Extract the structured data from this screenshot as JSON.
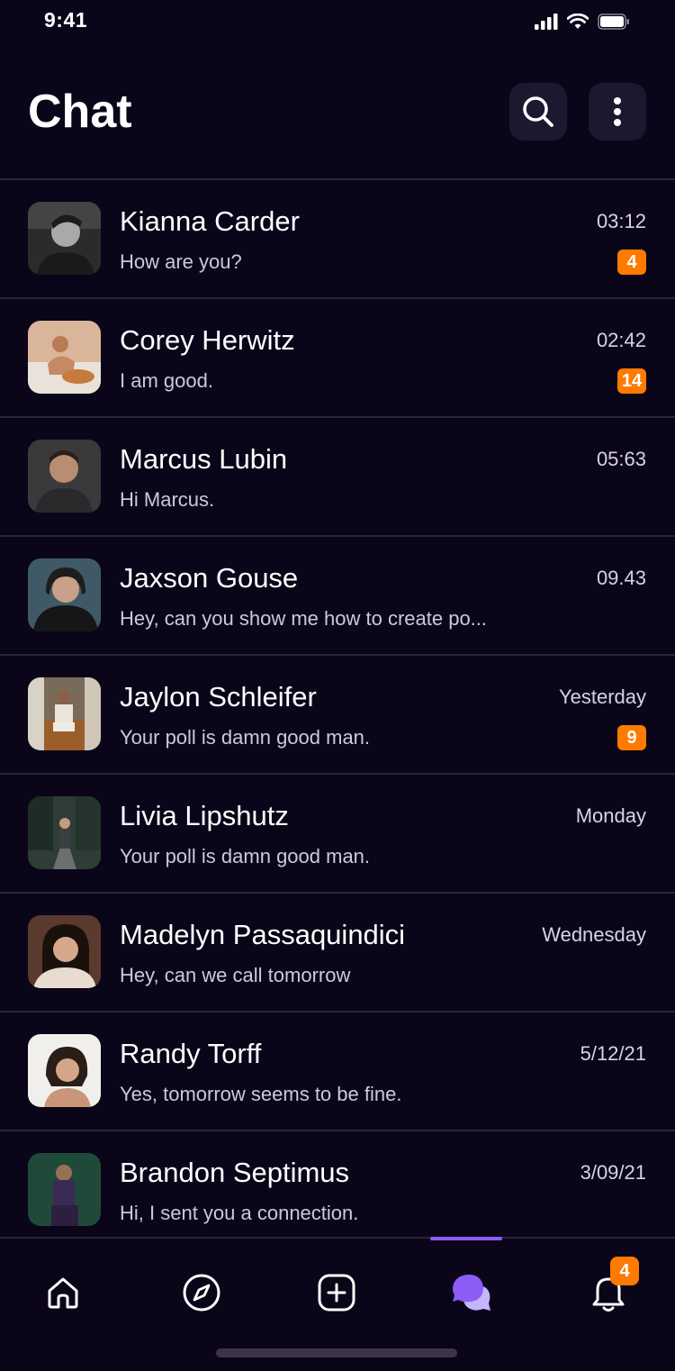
{
  "status_bar": {
    "time": "9:41"
  },
  "header": {
    "title": "Chat"
  },
  "chats": [
    {
      "name": "Kianna Carder",
      "preview": "How are you?",
      "time": "03:12",
      "unread": "4"
    },
    {
      "name": "Corey Herwitz",
      "preview": "I am good.",
      "time": "02:42",
      "unread": "14"
    },
    {
      "name": "Marcus Lubin",
      "preview": "Hi Marcus.",
      "time": "05:63",
      "unread": ""
    },
    {
      "name": "Jaxson Gouse",
      "preview": "Hey, can you show me how to create po...",
      "time": "09.43",
      "unread": ""
    },
    {
      "name": "Jaylon Schleifer",
      "preview": "Your poll is damn good man.",
      "time": "Yesterday",
      "unread": "9"
    },
    {
      "name": "Livia Lipshutz",
      "preview": "Your poll is damn good man.",
      "time": "Monday",
      "unread": ""
    },
    {
      "name": "Madelyn Passaquindici",
      "preview": "Hey, can we call tomorrow",
      "time": "Wednesday",
      "unread": ""
    },
    {
      "name": "Randy Torff",
      "preview": "Yes, tomorrow seems to be fine.",
      "time": "5/12/21",
      "unread": ""
    },
    {
      "name": "Brandon Septimus",
      "preview": "Hi, I sent you a connection.",
      "time": "3/09/21",
      "unread": ""
    }
  ],
  "tabbar": {
    "items": [
      "home-icon",
      "compass-icon",
      "add-square-icon",
      "chat-bubbles-icon",
      "bell-icon"
    ],
    "active": "chat-bubbles-icon",
    "notifications_badge": "4"
  },
  "colors": {
    "background": "#0b0519",
    "accent": "#8b5cf6",
    "badge": "#ff7a00",
    "divider": "#2a2538"
  }
}
